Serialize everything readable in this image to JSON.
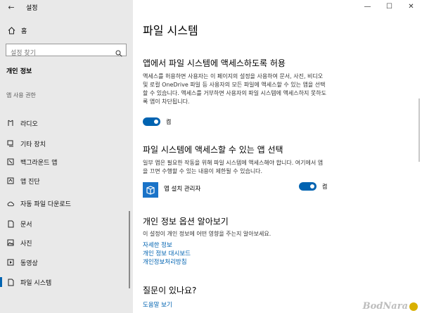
{
  "window": {
    "title": "설정",
    "controls": [
      "—",
      "☐",
      "✕"
    ]
  },
  "sidebar": {
    "home": "홈",
    "search_placeholder": "설정 찾기",
    "section": "개인 정보",
    "group": "앱 사용 권한",
    "items": [
      {
        "label": "라디오",
        "icon": "radio-icon"
      },
      {
        "label": "기타 장치",
        "icon": "devices-icon"
      },
      {
        "label": "백그라운드 앱",
        "icon": "background-apps-icon"
      },
      {
        "label": "앱 진단",
        "icon": "diagnostics-icon"
      },
      {
        "label": "자동 파일 다운로드",
        "icon": "cloud-icon"
      },
      {
        "label": "문서",
        "icon": "document-icon"
      },
      {
        "label": "사진",
        "icon": "picture-icon"
      },
      {
        "label": "동영상",
        "icon": "video-icon"
      },
      {
        "label": "파일 시스템",
        "icon": "file-icon"
      }
    ],
    "active_index": 8
  },
  "main": {
    "title": "파일 시스템",
    "allow": {
      "heading": "앱에서 파일 시스템에 액세스하도록 허용",
      "desc": "액세스를 허용하면 사용자는 이 페이지의 설정을 사용하여 문서, 사진, 비디오 및 로컬 OneDrive 파일 등 사용자의 모든 파일에 액세스할 수 있는 앱을 선택할 수 있습니다. 액세스를 거부하면 사용자의 파일 시스템에 액세스하지 못하도록 앱이 차단됩니다.",
      "toggle_state": "켬"
    },
    "choose": {
      "heading": "파일 시스템에 액세스할 수 있는 앱 선택",
      "desc": "일부 앱은 필요한 작동을 위해 파일 시스템에 액세스해야 합니다. 여기에서 앱을 끄면 수행할 수 있는 내용이 제한될 수 있습니다.",
      "app_name": "앱 설치 관리자",
      "toggle_state": "켬"
    },
    "privacy": {
      "heading": "개인 정보 옵션 알아보기",
      "desc": "이 설정이 개인 정보에 어떤 영향을 주는지 알아보세요.",
      "links": [
        "자세한 정보",
        "개인 정보 대시보드",
        "개인정보처리방침"
      ]
    },
    "question": {
      "heading": "질문이 있나요?",
      "link": "도움말 보기"
    }
  },
  "watermark": "BodNara",
  "colors": {
    "accent": "#0063b1",
    "sidebar_bg": "#e9e9e9"
  }
}
